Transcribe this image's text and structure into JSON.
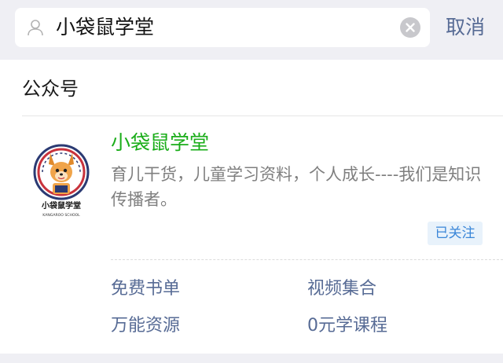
{
  "search": {
    "query": "小袋鼠学堂",
    "cancel_label": "取消"
  },
  "section": {
    "title": "公众号"
  },
  "account": {
    "name": "小袋鼠学堂",
    "description": "育儿干货，儿童学习资料，个人成长----我们是知识传播者。",
    "follow_status": "已关注",
    "logo_text": "小袋鼠学堂",
    "logo_subtext": "KANGAROO SCHOOL"
  },
  "menu": {
    "items": [
      {
        "label": "免费书单"
      },
      {
        "label": "视频集合"
      },
      {
        "label": "万能资源"
      },
      {
        "label": "0元学课程"
      }
    ]
  },
  "icons": {
    "search": "user-icon",
    "clear": "clear-icon"
  },
  "colors": {
    "accent_green": "#1aad19",
    "link_blue": "#576b95",
    "badge_blue": "#3a86d8"
  }
}
